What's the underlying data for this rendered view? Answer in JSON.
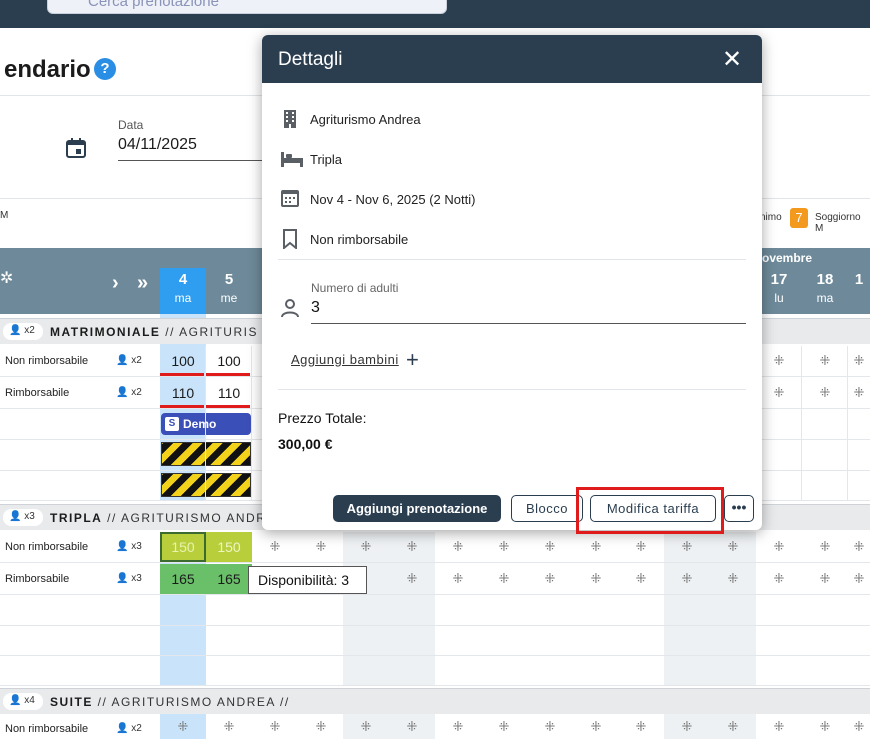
{
  "search": {
    "placeholder": "Cerca prenotazione"
  },
  "page": {
    "title": "endario",
    "help_icon": "?"
  },
  "date": {
    "label": "Data",
    "value": "04/11/2025"
  },
  "legend": {
    "left": "M",
    "min_stay": "nimo",
    "badge": "7",
    "stay_label": "Soggiorno M"
  },
  "grid": {
    "nav_next": "›",
    "nav_fast": "»",
    "month": "ovembre",
    "days": [
      {
        "num": "4",
        "name": "ma"
      },
      {
        "num": "5",
        "name": "me"
      },
      {
        "num": "17",
        "name": "lu"
      },
      {
        "num": "18",
        "name": "ma"
      },
      {
        "num": "1",
        "name": ""
      }
    ]
  },
  "sections": [
    {
      "badge": "x2",
      "type": "MATRIMONIALE",
      "rest": " // AGRITURIS"
    },
    {
      "badge": "x3",
      "type": "TRIPLA",
      "rest": " // AGRITURISMO ANDRE"
    },
    {
      "badge": "x4",
      "type": "SUITE",
      "rest": " // AGRITURISMO ANDREA //"
    }
  ],
  "rows": {
    "matr_nr": {
      "label": "Non rimborsabile",
      "cap": "x2",
      "p1": "100",
      "p2": "100"
    },
    "matr_r": {
      "label": "Rimborsabile",
      "cap": "x2",
      "p1": "110",
      "p2": "110"
    },
    "tripla_nr": {
      "label": "Non rimborsabile",
      "cap": "x3",
      "p1": "150",
      "p2": "150"
    },
    "tripla_r": {
      "label": "Rimborsabile",
      "cap": "x3",
      "p1": "165",
      "p2": "165"
    },
    "suite_nr": {
      "label": "Non rimborsabile",
      "cap": "x2"
    }
  },
  "booking": {
    "demo_label": "Demo"
  },
  "tooltip": {
    "text": "Disponibilità: 3"
  },
  "dialog": {
    "title": "Dettagli",
    "close": "✕",
    "property": "Agriturismo Andrea",
    "room": "Tripla",
    "dates": "Nov 4 - Nov 6, 2025 (2 Notti)",
    "rate": "Non rimborsabile",
    "adults_label": "Numero di adulti",
    "adults_value": "3",
    "add_children": "Aggiungi bambini",
    "add_icon": "+",
    "total_label": "Prezzo Totale:",
    "total_value": "300,00 €",
    "btn_add": "Aggiungi prenotazione",
    "btn_block": "Blocco",
    "btn_edit_rate": "Modifica tariffa",
    "btn_more": "•••"
  },
  "colors": {
    "header": "#2b3e50",
    "grid_header": "#6e8a9a",
    "selected_day": "#2f9df0",
    "highlight": "#e01b1b"
  }
}
